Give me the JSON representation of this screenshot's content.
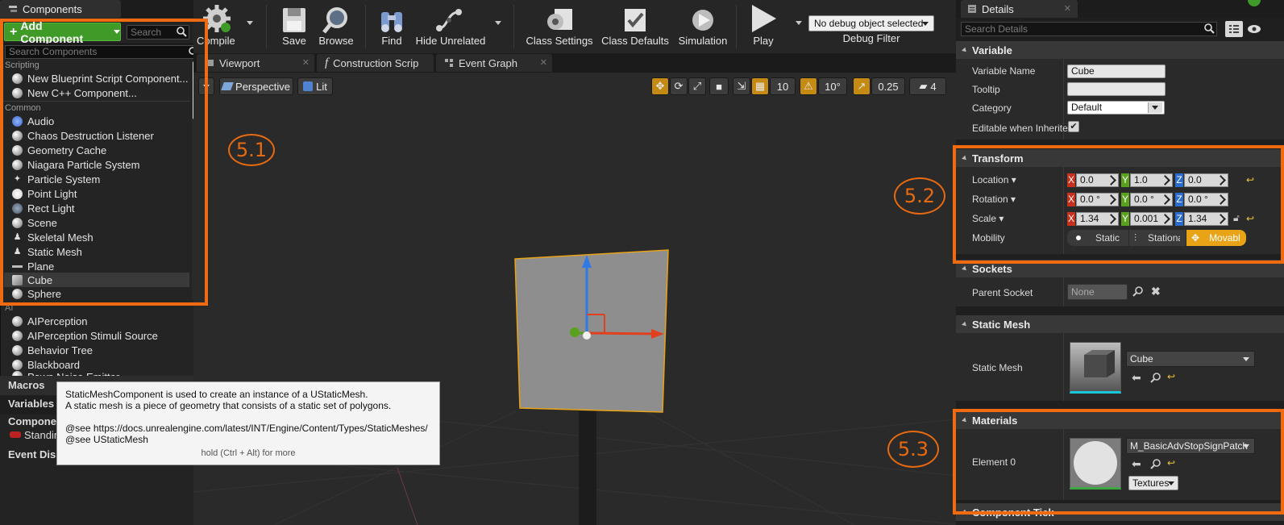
{
  "components_panel": {
    "tab_label": "Components",
    "add_button_label": "Add Component",
    "search_placeholder": "Search",
    "dropdown": {
      "search_placeholder": "Search Components",
      "sections": {
        "scripting": "Scripting",
        "common": "Common",
        "ai": "AI"
      },
      "scripting_items": [
        "New Blueprint Script Component...",
        "New C++ Component..."
      ],
      "common_items": [
        "Audio",
        "Chaos Destruction Listener",
        "Geometry Cache",
        "Niagara Particle System",
        "Particle System",
        "Point Light",
        "Rect Light",
        "Scene",
        "Skeletal Mesh",
        "Static Mesh",
        "Plane",
        "Cube",
        "Sphere"
      ],
      "ai_items": [
        "AIPerception",
        "AIPerception Stimuli Source",
        "Behavior Tree",
        "Blackboard",
        "Pawn Noise Emitter"
      ],
      "selected_item": "Cube"
    },
    "lower": {
      "macros": "Macros",
      "variables": "Variables",
      "components": "Components",
      "standing": "Standing",
      "event_dispatchers": "Event Dispatchers"
    }
  },
  "tooltip": {
    "line1": "StaticMeshComponent is used to create an instance of a UStaticMesh.",
    "line2": "A static mesh is a piece of geometry that consists of a static set of polygons.",
    "line3": "@see https://docs.unrealengine.com/latest/INT/Engine/Content/Types/StaticMeshes/",
    "line4": "@see UStaticMesh",
    "hint": "hold (Ctrl + Alt) for more"
  },
  "toolbar": {
    "compile": "Compile",
    "save": "Save",
    "browse": "Browse",
    "find": "Find",
    "hide_unrelated": "Hide Unrelated",
    "class_settings": "Class Settings",
    "class_defaults": "Class Defaults",
    "simulation": "Simulation",
    "play": "Play",
    "debug_selector": "No debug object selected",
    "debug_filter": "Debug Filter"
  },
  "editor_tabs": [
    "Viewport",
    "Construction Scrip",
    "Event Graph"
  ],
  "viewport": {
    "perspective": "Perspective",
    "lit": "Lit",
    "grid_snap": "10",
    "rotation_snap": "10°",
    "scale_snap": "0.25",
    "camera_speed": "4"
  },
  "annotations": [
    "5.1",
    "5.2",
    "5.3"
  ],
  "details": {
    "tab_label": "Details",
    "search_placeholder": "Search Details",
    "variable": {
      "header": "Variable",
      "name_label": "Variable Name",
      "name_value": "Cube",
      "tooltip_label": "Tooltip",
      "tooltip_value": "",
      "category_label": "Category",
      "category_value": "Default",
      "editable_label": "Editable when Inherited",
      "editable_checked": true
    },
    "transform": {
      "header": "Transform",
      "location_label": "Location",
      "location": [
        "0.0",
        "1.0",
        "0.0"
      ],
      "rotation_label": "Rotation",
      "rotation": [
        "0.0 °",
        "0.0 °",
        "0.0 °"
      ],
      "scale_label": "Scale",
      "scale": [
        "1.34",
        "0.001",
        "1.34"
      ],
      "mobility_label": "Mobility",
      "mobility_options": [
        "Static",
        "Stationary",
        "Movable"
      ],
      "mobility_selected": "Movable"
    },
    "sockets": {
      "header": "Sockets",
      "parent_label": "Parent Socket",
      "parent_value": "None"
    },
    "static_mesh": {
      "header": "Static Mesh",
      "label": "Static Mesh",
      "value": "Cube"
    },
    "materials": {
      "header": "Materials",
      "element_label": "Element 0",
      "value": "M_BasicAdvStopSignPatch",
      "textures_button": "Textures"
    },
    "component_tick": {
      "header": "Component Tick"
    }
  },
  "colors": {
    "accent_green": "#3f9a28",
    "highlight_orange": "#f06a10",
    "selection_gold": "#e8a317",
    "axis_x": "#c8301e",
    "axis_y": "#5aa11e",
    "axis_z": "#2b6bc9"
  }
}
